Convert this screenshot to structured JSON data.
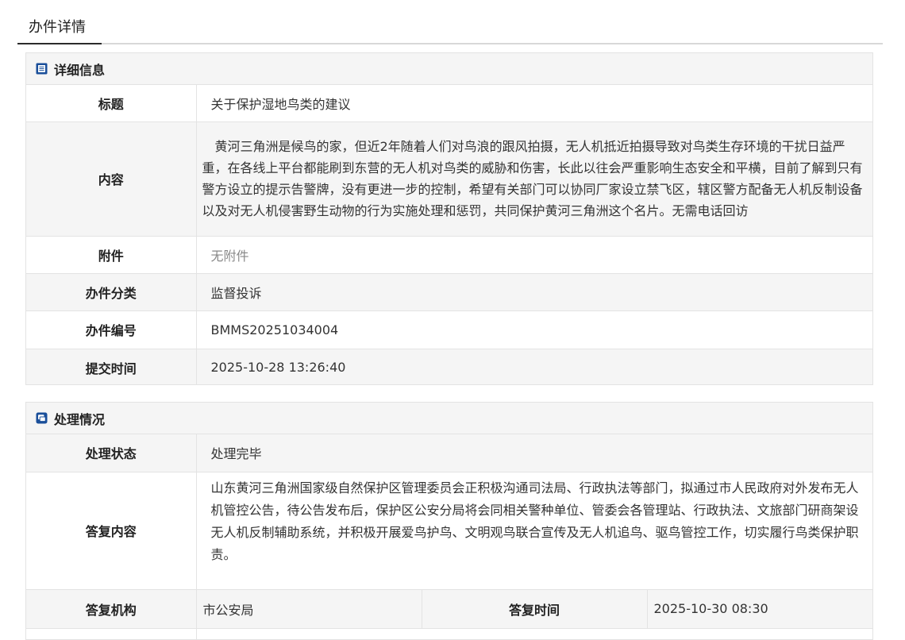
{
  "tab": {
    "label": "办件详情"
  },
  "detail": {
    "title": "详细信息",
    "rows": [
      {
        "label": "标题",
        "value": "关于保护湿地鸟类的建议"
      },
      {
        "label": "内容",
        "value": "　黄河三角洲是候鸟的家，但近2年随着人们对鸟浪的跟风拍摄，无人机抵近拍摄导致对鸟类生存环境的干扰日益严重，在各线上平台都能刷到东营的无人机对鸟类的威胁和伤害，长此以往会严重影响生态安全和平横，目前了解到只有警方设立的提示告警牌，没有更进一步的控制，希望有关部门可以协同厂家设立禁飞区，辖区警方配备无人机反制设备以及对无人机侵害野生动物的行为实施处理和惩罚，共同保护黄河三角洲这个名片。无需电话回访"
      },
      {
        "label": "附件",
        "value": "无附件"
      },
      {
        "label": "办件分类",
        "value": "监督投诉"
      },
      {
        "label": "办件编号",
        "value": "BMMS20251034004"
      },
      {
        "label": "提交时间",
        "value": "2025-10-28 13:26:40"
      }
    ]
  },
  "process": {
    "title": "处理情况",
    "status": {
      "label": "处理状态",
      "value": "处理完毕"
    },
    "reply": {
      "label": "答复内容",
      "value": "山东黄河三角洲国家级自然保护区管理委员会正积极沟通司法局、行政执法等部门，拟通过市人民政府对外发布无人机管控公告，待公告发布后，保护区公安分局将会同相关警种单位、管委会各管理站、行政执法、文旅部门研商架设无人机反制辅助系统，并积极开展爱鸟护鸟、文明观鸟联合宣传及无人机追鸟、驱鸟管控工作，切实履行鸟类保护职责。"
    },
    "org": {
      "label": "答复机构",
      "value": "市公安局"
    },
    "time": {
      "label": "答复时间",
      "value": "2025-10-30 08:30"
    }
  },
  "colors": {
    "icon_blue": "#1a4f9a",
    "label_bg": "#f5f5f5",
    "border": "#e3e3e3"
  }
}
